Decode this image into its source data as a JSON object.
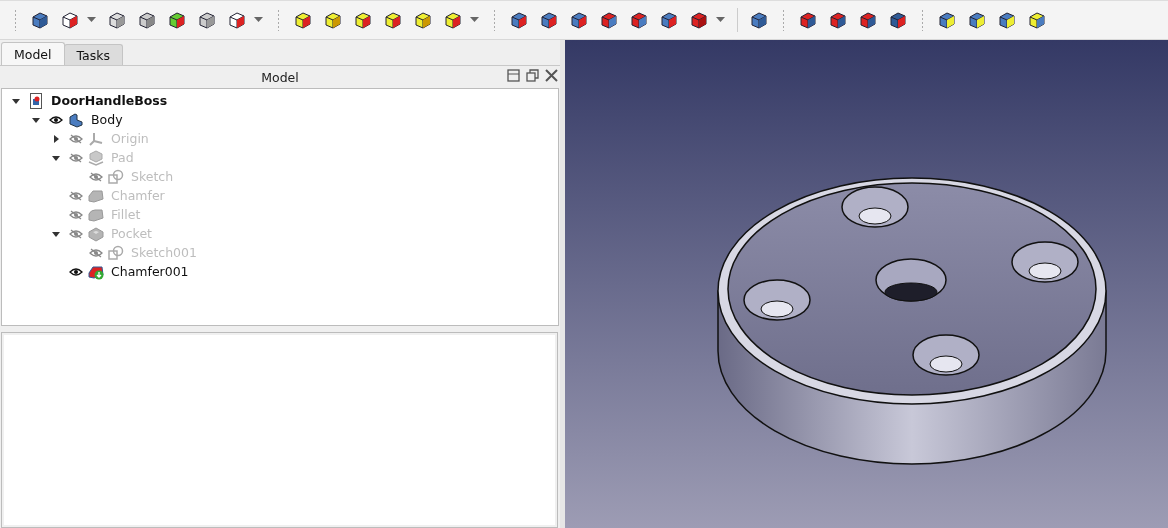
{
  "tabs": [
    {
      "label": "Model",
      "selected": true
    },
    {
      "label": "Tasks",
      "selected": false
    }
  ],
  "panel": {
    "title": "Model"
  },
  "tree": [
    {
      "label": "DoorHandleBoss",
      "kind": "document",
      "expanded": true,
      "children": [
        {
          "label": "Body",
          "kind": "body",
          "visible": true,
          "expanded": true,
          "children": [
            {
              "label": "Origin",
              "kind": "origin",
              "visible": false,
              "expanded": false
            },
            {
              "label": "Pad",
              "kind": "pad",
              "visible": false,
              "expanded": true,
              "children": [
                {
                  "label": "Sketch",
                  "kind": "sketch",
                  "visible": false
                }
              ]
            },
            {
              "label": "Chamfer",
              "kind": "chamfer",
              "visible": false
            },
            {
              "label": "Fillet",
              "kind": "fillet",
              "visible": false
            },
            {
              "label": "Pocket",
              "kind": "pocket",
              "visible": false,
              "expanded": true,
              "children": [
                {
                  "label": "Sketch001",
                  "kind": "sketch",
                  "visible": false
                }
              ]
            },
            {
              "label": "Chamfer001",
              "kind": "feature",
              "visible": true
            }
          ]
        }
      ]
    }
  ]
}
